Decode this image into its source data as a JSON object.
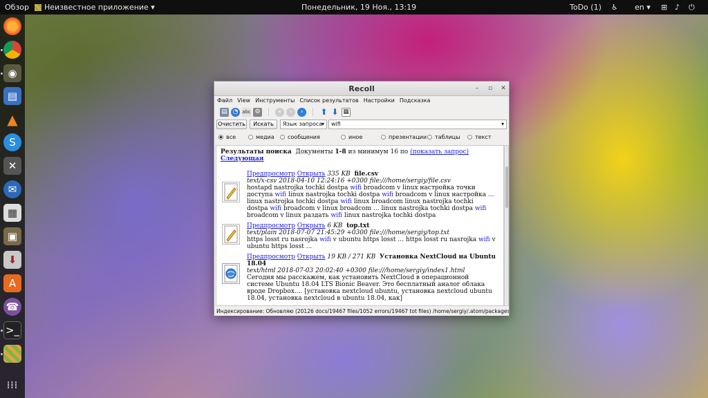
{
  "topbar": {
    "overview": "Обзор",
    "app": "Неизвестное приложение ▾",
    "clock": "Понедельник, 19 Ноя., 13:19",
    "todo": "ToDo (1)",
    "lang": "en ▾"
  },
  "window": {
    "title": "Recoll"
  },
  "menu": [
    "Файл",
    "View",
    "Инструменты",
    "Список результатов",
    "Настройки",
    "Подсказка"
  ],
  "search": {
    "clear": "Очистить",
    "search": "Искать",
    "query_lang": "Язык запроса",
    "query": "wifi"
  },
  "filters": [
    "все",
    "медиа",
    "сообщения",
    "иное",
    "презентации",
    "таблицы",
    "текст"
  ],
  "results": {
    "header_title": "Результаты поиска",
    "header_docs": "Документы",
    "header_range": "1-8",
    "header_of": "из минимум 16 по",
    "header_link": "(показать запрос)",
    "next": "Следующая",
    "preview": "Предпросмотр",
    "open": "Открыть",
    "items": [
      {
        "size": "335 KB",
        "name": "file.csv",
        "meta": "text/x-csv   2018-04-10 12:24:16 +0300     file:///home/sergiy/file.csv"
      },
      {
        "size": "6 KB",
        "name": "top.txt",
        "meta": "text/plain   2018-07-07 21:45:29 +0300     file:///home/sergiy/top.txt"
      },
      {
        "size": "19 KB / 271 KB",
        "name": "Установка NextCloud на Ubuntu 18.04",
        "meta": "text/html   2018-07-03 20:02:40 +0300     file:///home/sergiy/index1.html",
        "text": "Сегодня мы расскажем, как установить NextCloud в операционной системе Ubuntu 18.04 LTS Bionic Beaver. Это бесплатный аналог облака вроде Dropbox.... [установка nextcloud ubuntu, установка nextcloud ubuntu 18.04, установка nextcloud в ubuntu 18.04, как]"
      }
    ]
  },
  "status": "Индексирование: Обновляю (20126 docs/19467 files/1052 errors/19467 tot files) /home/sergiy/.atom/packages/"
}
